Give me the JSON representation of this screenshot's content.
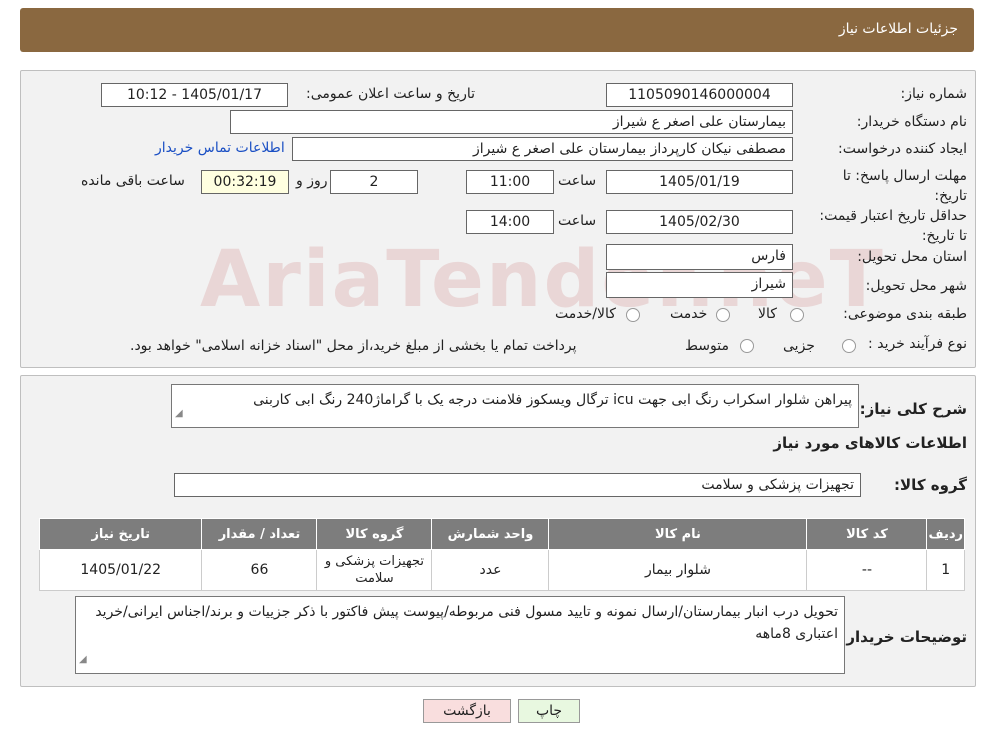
{
  "header": {
    "title": "جزئیات اطلاعات نیاز"
  },
  "watermark": "AriaTender.neT",
  "form": {
    "need_number": {
      "label": "شماره نیاز:",
      "value": "1105090146000004"
    },
    "announce_datetime": {
      "label": "تاریخ و ساعت اعلان عمومی:",
      "value": "1405/01/17 - 10:12"
    },
    "buyer_org": {
      "label": "نام دستگاه خریدار:",
      "value": "بیمارستان علی اصغر  ع  شیراز"
    },
    "requester": {
      "label": "ایجاد کننده درخواست:",
      "value": "مصطفی نیکان کارپرداز بیمارستان علی اصغر  ع  شیراز",
      "contact_link": "اطلاعات تماس خریدار"
    },
    "response_deadline": {
      "label": "مهلت ارسال پاسخ: تا تاریخ:",
      "date": "1405/01/19",
      "time_label": "ساعت",
      "time": "11:00",
      "days": "2",
      "days_label": "روز و",
      "remaining": "00:32:19",
      "remaining_label": "ساعت باقی مانده"
    },
    "price_validity": {
      "label": "حداقل تاریخ اعتبار قیمت: تا تاریخ:",
      "date": "1405/02/30",
      "time_label": "ساعت",
      "time": "14:00"
    },
    "province": {
      "label": "استان محل تحویل:",
      "value": "فارس"
    },
    "city": {
      "label": "شهر محل تحویل:",
      "value": "شیراز"
    },
    "category": {
      "label": "طبقه بندی موضوعی:",
      "options": [
        "کالا",
        "خدمت",
        "کالا/خدمت"
      ]
    },
    "purchase_type": {
      "label": "نوع فرآیند خرید :",
      "options": [
        "جزیی",
        "متوسط"
      ],
      "note": "پرداخت تمام یا بخشی از مبلغ خرید،از محل \"اسناد خزانه اسلامی\" خواهد بود."
    }
  },
  "details": {
    "summary_label": "شرح کلی نیاز:",
    "summary_text": "پیراهن شلوار اسکراب رنگ ابی جهت icu ترگال ویسکوز فلامنت درجه یک با گراماژ240  رنگ ابی کاربنی",
    "goods_info_title": "اطلاعات کالاهای مورد نیاز",
    "goods_group_label": "گروه کالا:",
    "goods_group_value": "تجهیزات پزشکی و سلامت",
    "table": {
      "headers": [
        "ردیف",
        "کد کالا",
        "نام کالا",
        "واحد شمارش",
        "گروه کالا",
        "تعداد / مقدار",
        "تاریخ نیاز"
      ],
      "rows": [
        [
          "1",
          "--",
          "شلوار بیمار",
          "عدد",
          "تجهیزات پزشکی و سلامت",
          "66",
          "1405/01/22"
        ]
      ]
    },
    "buyer_notes_label": "توضیحات خریدار:",
    "buyer_notes_text": "تحویل درب انبار بیمارستان/ارسال نمونه و تایید مسول فنی مربوطه/پیوست پیش فاکتور با ذکر جزییات و برند/اجناس ایرانی/خرید اعتباری 8ماهه"
  },
  "buttons": {
    "print": "چاپ",
    "back": "بازگشت"
  }
}
